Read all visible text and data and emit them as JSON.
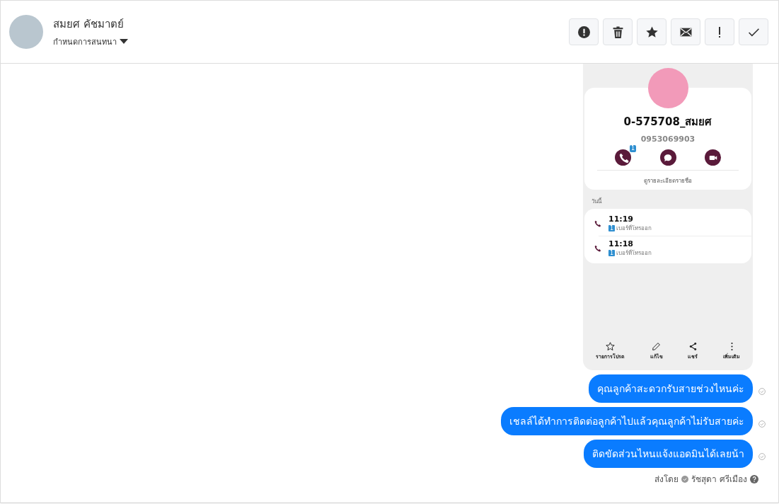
{
  "header": {
    "contact_name": "สมยศ คัชมาตย์",
    "subtitle": "กำหนดการสนทนา ",
    "actions": [
      {
        "kind": "alert"
      },
      {
        "kind": "trash"
      },
      {
        "kind": "star"
      },
      {
        "kind": "mail"
      },
      {
        "kind": "exclaim"
      },
      {
        "kind": "check"
      }
    ]
  },
  "attachment": {
    "contact_title": "0-575708_สมยศ",
    "phone": "0953069903",
    "call_badge": "1",
    "details_link": "ดูรายละเอียดรายชื่อ",
    "section": "วันนี้",
    "calls": [
      {
        "time": "11:19",
        "label": "เบอร์ที่โทรออก",
        "sim": "1"
      },
      {
        "time": "11:18",
        "label": "เบอร์ที่โทรออก",
        "sim": "1"
      }
    ],
    "bottom_actions": [
      {
        "kind": "star",
        "label": "รายการโปรด"
      },
      {
        "kind": "edit",
        "label": "แก้ไข"
      },
      {
        "kind": "share",
        "label": "แชร์"
      },
      {
        "kind": "more",
        "label": "เพิ่มเติม"
      }
    ]
  },
  "messages": [
    {
      "text": "คุณลูกค้าสะดวกรับสายช่วงไหนค่ะ"
    },
    {
      "text": "เชลล์ได้ทำการติดต่อลูกค้าไปแล้วคุณลูกค้าไม่รับสายค่ะ"
    },
    {
      "text": "ติดขัดส่วนไหนแจ้งแอดมินได้เลยน้า"
    }
  ],
  "sent_by": {
    "label": "ส่งโดย",
    "agent": "รัชสุดา ศรีเมือง"
  }
}
